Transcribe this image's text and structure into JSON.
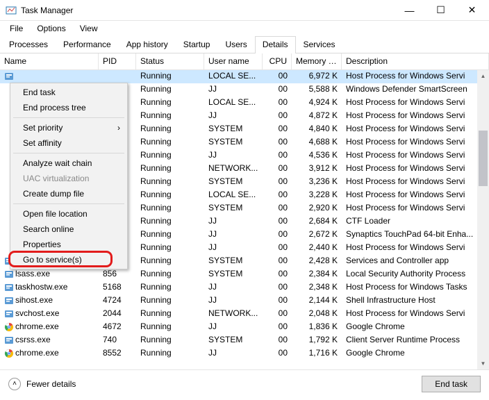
{
  "window": {
    "title": "Task Manager",
    "controls": {
      "min": "—",
      "max": "☐",
      "close": "✕"
    }
  },
  "menu": {
    "items": [
      "File",
      "Options",
      "View"
    ]
  },
  "tabs": {
    "items": [
      "Processes",
      "Performance",
      "App history",
      "Startup",
      "Users",
      "Details",
      "Services"
    ],
    "active": "Details"
  },
  "columns": [
    "Name",
    "PID",
    "Status",
    "User name",
    "CPU",
    "Memory (p...",
    "Description"
  ],
  "rows": [
    {
      "icon": "svc",
      "name": "",
      "pid": "",
      "status": "Running",
      "user": "LOCAL SE...",
      "cpu": "00",
      "mem": "6,972 K",
      "desc": "Host Process for Windows Servi",
      "sel": true
    },
    {
      "icon": "none",
      "name": "",
      "pid": "",
      "status": "Running",
      "user": "JJ",
      "cpu": "00",
      "mem": "5,588 K",
      "desc": "Windows Defender SmartScreen"
    },
    {
      "icon": "none",
      "name": "",
      "pid": "",
      "status": "Running",
      "user": "LOCAL SE...",
      "cpu": "00",
      "mem": "4,924 K",
      "desc": "Host Process for Windows Servi"
    },
    {
      "icon": "none",
      "name": "",
      "pid": "",
      "status": "Running",
      "user": "JJ",
      "cpu": "00",
      "mem": "4,872 K",
      "desc": "Host Process for Windows Servi"
    },
    {
      "icon": "none",
      "name": "",
      "pid": "",
      "status": "Running",
      "user": "SYSTEM",
      "cpu": "00",
      "mem": "4,840 K",
      "desc": "Host Process for Windows Servi"
    },
    {
      "icon": "none",
      "name": "",
      "pid": "",
      "status": "Running",
      "user": "SYSTEM",
      "cpu": "00",
      "mem": "4,688 K",
      "desc": "Host Process for Windows Servi"
    },
    {
      "icon": "none",
      "name": "",
      "pid": "",
      "status": "Running",
      "user": "JJ",
      "cpu": "00",
      "mem": "4,536 K",
      "desc": "Host Process for Windows Servi"
    },
    {
      "icon": "none",
      "name": "",
      "pid": "",
      "status": "Running",
      "user": "NETWORK...",
      "cpu": "00",
      "mem": "3,912 K",
      "desc": "Host Process for Windows Servi"
    },
    {
      "icon": "none",
      "name": "",
      "pid": "",
      "status": "Running",
      "user": "SYSTEM",
      "cpu": "00",
      "mem": "3,236 K",
      "desc": "Host Process for Windows Servi"
    },
    {
      "icon": "none",
      "name": "",
      "pid": "",
      "status": "Running",
      "user": "LOCAL SE...",
      "cpu": "00",
      "mem": "3,228 K",
      "desc": "Host Process for Windows Servi"
    },
    {
      "icon": "none",
      "name": "",
      "pid": "",
      "status": "Running",
      "user": "SYSTEM",
      "cpu": "00",
      "mem": "2,920 K",
      "desc": "Host Process for Windows Servi"
    },
    {
      "icon": "none",
      "name": "",
      "pid": "",
      "status": "Running",
      "user": "JJ",
      "cpu": "00",
      "mem": "2,684 K",
      "desc": "CTF Loader"
    },
    {
      "icon": "none",
      "name": "",
      "pid": "",
      "status": "Running",
      "user": "JJ",
      "cpu": "00",
      "mem": "2,672 K",
      "desc": "Synaptics TouchPad 64-bit Enha..."
    },
    {
      "icon": "none",
      "name": "",
      "pid": "",
      "status": "Running",
      "user": "JJ",
      "cpu": "00",
      "mem": "2,440 K",
      "desc": "Host Process for Windows Servi"
    },
    {
      "icon": "svc",
      "name": "services.exe",
      "pid": "792",
      "status": "Running",
      "user": "SYSTEM",
      "cpu": "00",
      "mem": "2,428 K",
      "desc": "Services and Controller app"
    },
    {
      "icon": "svc",
      "name": "lsass.exe",
      "pid": "856",
      "status": "Running",
      "user": "SYSTEM",
      "cpu": "00",
      "mem": "2,384 K",
      "desc": "Local Security Authority Process"
    },
    {
      "icon": "svc",
      "name": "taskhostw.exe",
      "pid": "5168",
      "status": "Running",
      "user": "JJ",
      "cpu": "00",
      "mem": "2,348 K",
      "desc": "Host Process for Windows Tasks"
    },
    {
      "icon": "svc",
      "name": "sihost.exe",
      "pid": "4724",
      "status": "Running",
      "user": "JJ",
      "cpu": "00",
      "mem": "2,144 K",
      "desc": "Shell Infrastructure Host"
    },
    {
      "icon": "svc",
      "name": "svchost.exe",
      "pid": "2044",
      "status": "Running",
      "user": "NETWORK...",
      "cpu": "00",
      "mem": "2,048 K",
      "desc": "Host Process for Windows Servi"
    },
    {
      "icon": "chrome",
      "name": "chrome.exe",
      "pid": "4672",
      "status": "Running",
      "user": "JJ",
      "cpu": "00",
      "mem": "1,836 K",
      "desc": "Google Chrome"
    },
    {
      "icon": "svc",
      "name": "csrss.exe",
      "pid": "740",
      "status": "Running",
      "user": "SYSTEM",
      "cpu": "00",
      "mem": "1,792 K",
      "desc": "Client Server Runtime Process"
    },
    {
      "icon": "chrome",
      "name": "chrome.exe",
      "pid": "8552",
      "status": "Running",
      "user": "JJ",
      "cpu": "00",
      "mem": "1,716 K",
      "desc": "Google Chrome"
    }
  ],
  "context_menu": {
    "items": [
      {
        "label": "End task"
      },
      {
        "label": "End process tree"
      },
      {
        "sep": true
      },
      {
        "label": "Set priority",
        "sub": true
      },
      {
        "label": "Set affinity"
      },
      {
        "sep": true
      },
      {
        "label": "Analyze wait chain"
      },
      {
        "label": "UAC virtualization",
        "disabled": true
      },
      {
        "label": "Create dump file"
      },
      {
        "sep": true
      },
      {
        "label": "Open file location"
      },
      {
        "label": "Search online"
      },
      {
        "label": "Properties"
      },
      {
        "label": "Go to service(s)",
        "hl": true
      }
    ]
  },
  "footer": {
    "fewer": "Fewer details",
    "end_task": "End task"
  },
  "icons": {
    "svc_color": "#3b78e7",
    "chrome_colors": [
      "#ea4335",
      "#fbbc05",
      "#34a853",
      "#4285f4"
    ]
  }
}
